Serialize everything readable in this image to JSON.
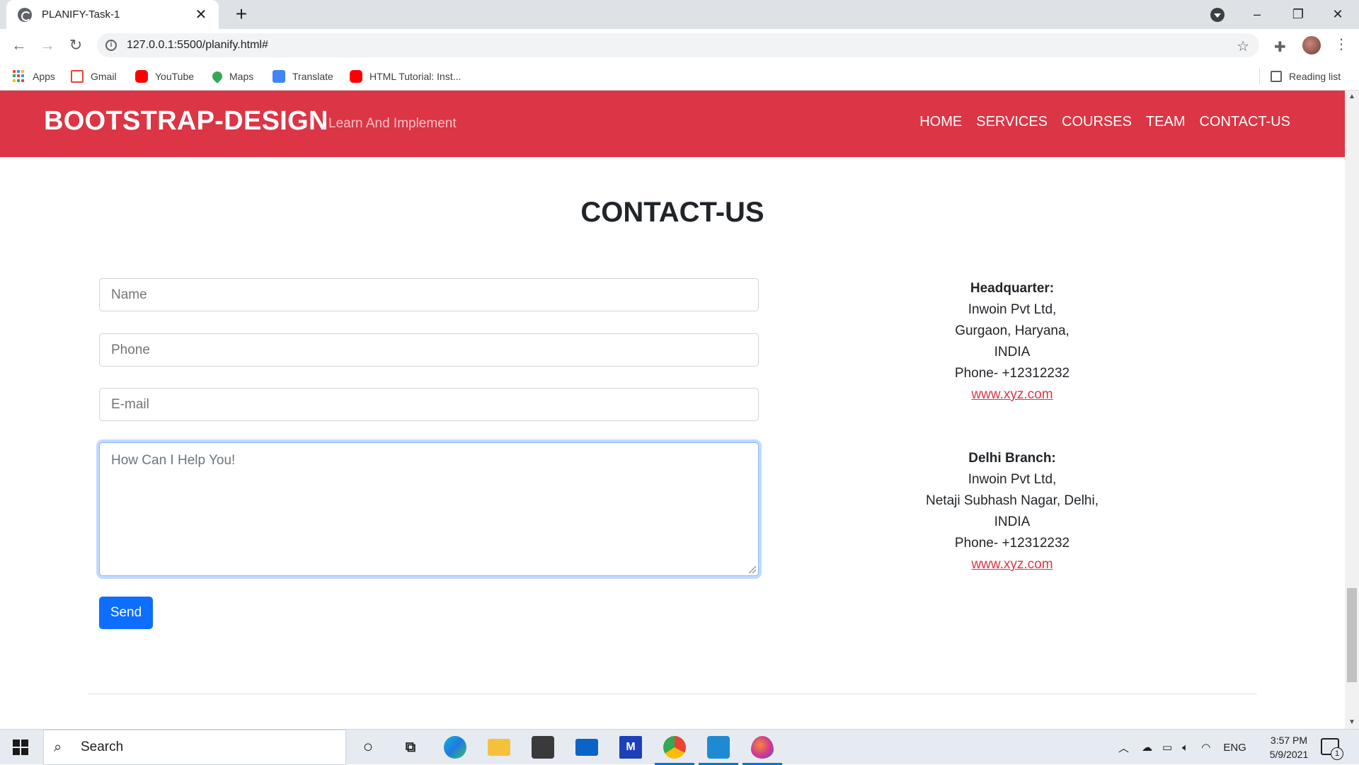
{
  "browser": {
    "tab_title": "PLANIFY-Task-1",
    "tab_close": "✕",
    "new_tab": "+",
    "url": "127.0.0.1:5500/planify.html#",
    "window_controls": {
      "minimize": "–",
      "restore": "❐",
      "close": "✕"
    },
    "bookmarks": [
      {
        "label": "Apps",
        "icon": "apps-grid-icon"
      },
      {
        "label": "Gmail",
        "icon": "gmail-icon"
      },
      {
        "label": "YouTube",
        "icon": "youtube-icon"
      },
      {
        "label": "Maps",
        "icon": "maps-icon"
      },
      {
        "label": "Translate",
        "icon": "translate-icon"
      },
      {
        "label": "HTML Tutorial: Inst...",
        "icon": "youtube-icon"
      }
    ],
    "reading_list": "Reading list"
  },
  "navbar": {
    "brand": "BOOTSTRAP-DESIGN",
    "tagline": "Learn And Implement",
    "links": [
      "HOME",
      "SERVICES",
      "COURSES",
      "TEAM",
      "CONTACT-US"
    ],
    "bg_color": "#dc3545"
  },
  "contact": {
    "title": "CONTACT-US",
    "form": {
      "name_placeholder": "Name",
      "phone_placeholder": "Phone",
      "email_placeholder": "E-mail",
      "message_placeholder": "How Can I Help You!",
      "send_label": "Send"
    },
    "offices": [
      {
        "heading": "Headquarter:",
        "lines": [
          "Inwoin Pvt Ltd,",
          "Gurgaon, Haryana,",
          "INDIA",
          "Phone- +12312232"
        ],
        "link": "www.xyz.com"
      },
      {
        "heading": "Delhi Branch:",
        "lines": [
          "Inwoin Pvt Ltd,",
          "Netaji Subhash Nagar, Delhi,",
          "INDIA",
          "Phone- +12312232"
        ],
        "link": "www.xyz.com"
      }
    ]
  },
  "taskbar": {
    "search_label": "Search",
    "language": "ENG",
    "time": "3:57 PM",
    "date": "5/9/2021",
    "notification_count": "1"
  }
}
